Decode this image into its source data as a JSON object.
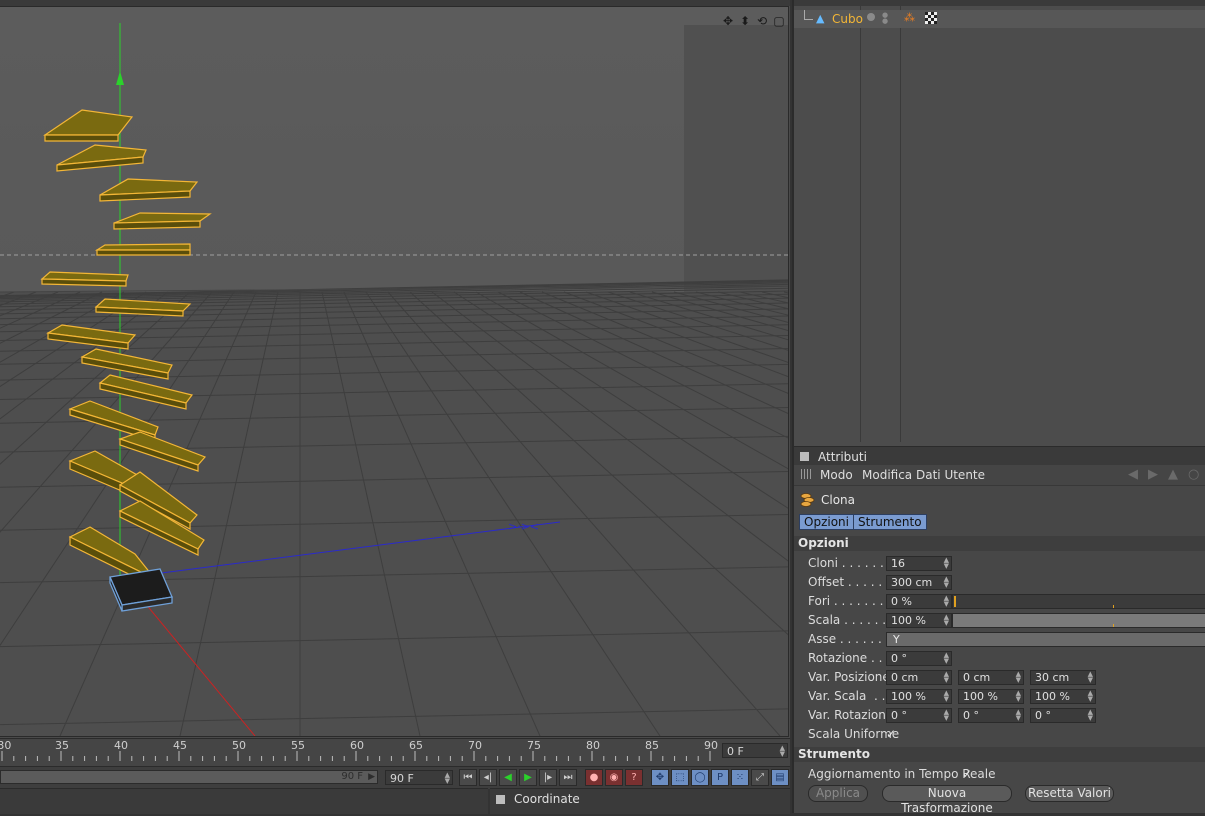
{
  "object_manager": {
    "object_name": "Cubo"
  },
  "attributes": {
    "title": "Attributi",
    "menu": [
      "Modo",
      "Modifica",
      "Dati Utente"
    ],
    "object_label": "Clona",
    "tabs": [
      "Opzioni",
      "Strumento"
    ],
    "options_section": "Opzioni",
    "props": {
      "cloni": {
        "label": "Cloni . . . . . . . .",
        "value": "16"
      },
      "offset": {
        "label": "Offset . . . . . .",
        "value": "300 cm"
      },
      "fori": {
        "label": "Fori . . . . . . . . .",
        "value": "0 %",
        "slider_fraction": 0.0
      },
      "scala": {
        "label": "Scala . . . . . . .",
        "value": "100 %",
        "slider_fraction": 1.0
      },
      "asse": {
        "label": "Asse . . . . . . . .",
        "value": "Y"
      },
      "rotazione": {
        "label": "Rotazione . . . .",
        "value": "0 °"
      },
      "var_posizione": {
        "label": "Var. Posizione",
        "values": [
          "0 cm",
          "0 cm",
          "30 cm"
        ]
      },
      "var_scala": {
        "label": "Var. Scala  . . .",
        "values": [
          "100 %",
          "100 %",
          "100 %"
        ]
      },
      "var_rotazione": {
        "label": "Var. Rotazione",
        "values": [
          "0 °",
          "0 °",
          "0 °"
        ]
      },
      "scala_uniforme": {
        "label": "Scala Uniforme",
        "checked": "✓"
      }
    },
    "tool_section": "Strumento",
    "realtime": {
      "label": "Aggiornamento in Tempo Reale",
      "checked": "✓"
    },
    "buttons": {
      "apply": "Applica",
      "new_transform": "Nuova Trasformazione",
      "reset": "Resetta Valori"
    }
  },
  "timeline": {
    "ticks": [
      "30",
      "35",
      "40",
      "45",
      "50",
      "55",
      "60",
      "65",
      "70",
      "75",
      "80",
      "85",
      "90"
    ],
    "current_frame": "0 F"
  },
  "transport": {
    "range_end": "90 F",
    "end_frame": "90 F"
  },
  "coordinates": {
    "title": "Coordinate"
  },
  "colors": {
    "selection": "#f3b636",
    "clone_fill": "#7a6a10",
    "axis_y": "#2bd22b",
    "axis_x": "#cc2222",
    "axis_z": "#2a2acc",
    "tab_active": "#7a9bd0"
  }
}
